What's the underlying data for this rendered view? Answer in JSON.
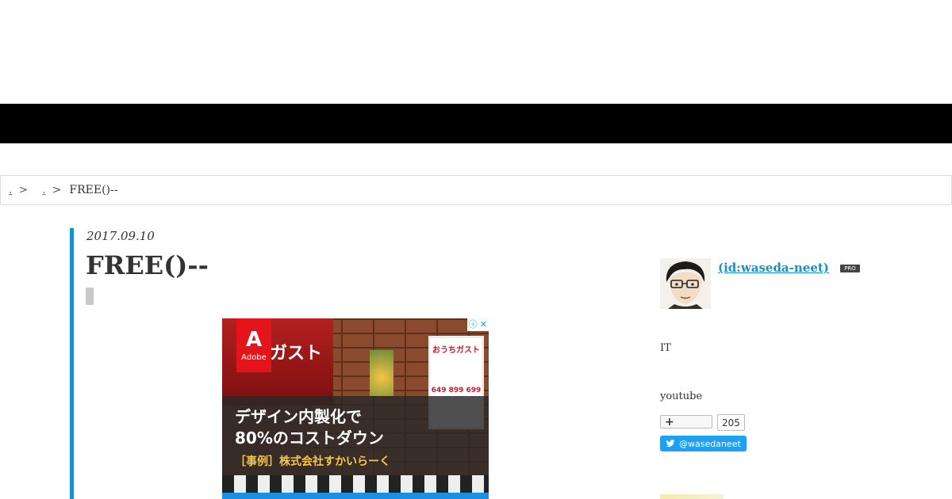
{
  "breadcrumb": {
    "home_link": ".",
    "category_link": ".",
    "separator": ">",
    "current": "FREE()--"
  },
  "entry": {
    "date": "2017.09.10",
    "title": "FREE()--"
  },
  "ad": {
    "adobe_label": "Adobe",
    "adobe_icon": "A",
    "store_sign": "ガスト",
    "poster_head": "おうちガスト",
    "poster_prices": "649 899 699",
    "headline_line1": "デザイン内製化で",
    "headline_line2": "80%のコストダウン",
    "subline": "［事例］株式会社すかいらーく",
    "info_icon": "ⓘ",
    "close_icon": "✕"
  },
  "profile": {
    "name": " (id:waseda-neet)",
    "badge": "PRO",
    "desc1": "IT",
    "desc2": "youtube",
    "follow_plus": "+",
    "follow_count": "205",
    "twitter_handle": "@wasedaneet"
  },
  "colors": {
    "accent": "#1a90c8",
    "header_bar": "#000000",
    "twitter": "#1da1f2"
  }
}
